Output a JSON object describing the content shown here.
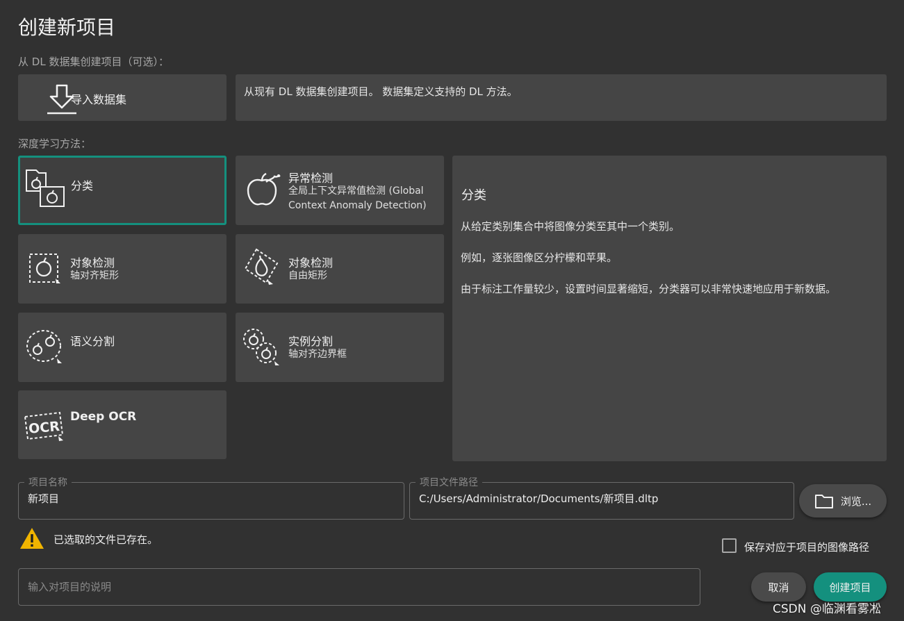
{
  "dialog": {
    "title": "创建新项目"
  },
  "dataset": {
    "section_label": "从 DL 数据集创建项目（可选）：",
    "import_label": "导入数据集",
    "import_icon": "import-arrow-icon",
    "description": "从现有 DL 数据集创建项目。 数据集定义支持的 DL 方法。"
  },
  "methods": {
    "section_label": "深度学习方法：",
    "items": [
      {
        "title": "分类",
        "subtitle": "",
        "icon": "classification-icon",
        "selected": true
      },
      {
        "title": "异常检测",
        "subtitle": "全局上下文异常值检测 (Global Context Anomaly Detection)",
        "icon": "anomaly-detection-icon",
        "selected": false
      },
      {
        "title": "对象检测",
        "subtitle": "轴对齐矩形",
        "icon": "object-detection-axis-aligned-icon",
        "selected": false
      },
      {
        "title": "对象检测",
        "subtitle": "自由矩形",
        "icon": "object-detection-oriented-icon",
        "selected": false
      },
      {
        "title": "语义分割",
        "subtitle": "",
        "icon": "semantic-segmentation-icon",
        "selected": false
      },
      {
        "title": "实例分割",
        "subtitle": "轴对齐边界框",
        "icon": "instance-segmentation-icon",
        "selected": false
      },
      {
        "title": "Deep OCR",
        "subtitle": "",
        "icon": "ocr-icon",
        "selected": false
      }
    ]
  },
  "description_panel": {
    "heading": "分类",
    "paragraphs": [
      "从给定类别集合中将图像分类至其中一个类别。",
      "例如，逐张图像区分柠檬和苹果。",
      "由于标注工作量较少，设置时间显著缩短，分类器可以非常快速地应用于新数据。"
    ]
  },
  "project_name": {
    "legend": "项目名称",
    "value": "新项目"
  },
  "project_path": {
    "legend": "项目文件路径",
    "value": "C:/Users/Administrator/Documents/新项目.dltp"
  },
  "browse": {
    "label": "浏览...",
    "icon": "folder-icon"
  },
  "warning": {
    "icon": "warning-triangle-icon",
    "text": "已选取的文件已存在。",
    "color": "#f0b400"
  },
  "save_paths": {
    "label": "保存对应于项目的图像路径",
    "checked": false
  },
  "description_input": {
    "placeholder": "输入对项目的说明"
  },
  "buttons": {
    "cancel": "取消",
    "create": "创建项目"
  },
  "watermark": "CSDN @临渊看雾凇",
  "colors": {
    "background": "#313131",
    "tile": "#454545",
    "accent": "#14907e"
  }
}
